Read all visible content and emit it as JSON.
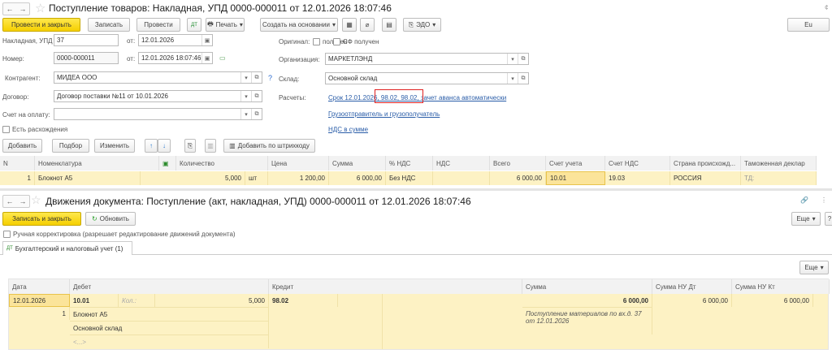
{
  "doc": {
    "title": "Поступление товаров: Накладная, УПД 0000-000011 от 12.01.2026 18:07:46",
    "toolbar": {
      "post_close": "Провести и закрыть",
      "save": "Записать",
      "post": "Провести",
      "print": "Печать",
      "create_based": "Создать на основании",
      "edo": "ЭДО",
      "more": "Eu"
    },
    "fields": {
      "invoice_label": "Накладная, УПД №:",
      "invoice_no": "37",
      "from": "от:",
      "invoice_date": "12.01.2026",
      "number_label": "Номер:",
      "number": "0000-000011",
      "doc_date": "12.01.2026 18:07:46",
      "counterparty_label": "Контрагент:",
      "counterparty": "МИДЕА ООО",
      "contract_label": "Договор:",
      "contract": "Договор поставки №11 от 10.01.2026",
      "payment_label": "Счет на оплату:",
      "payment": "",
      "discrepancy": "Есть расхождения",
      "original_label": "Оригинал:",
      "received": "получен",
      "sf_received": "СФ получен",
      "org_label": "Организация:",
      "org": "МАРКЕТЛЭНД",
      "warehouse_label": "Склад:",
      "warehouse": "Основной склад",
      "settlements_label": "Расчеты:",
      "settlements_link": "Срок 12.01.2026, 98.02, 98.02, зачет аванса автоматически",
      "shipper_link": "Грузоотправитель и грузополучатель",
      "vat_link": "НДС в сумме",
      "help": "?"
    },
    "table_toolbar": {
      "add": "Добавить",
      "pick": "Подбор",
      "edit": "Изменить",
      "add_barcode": "Добавить по штрихкоду"
    },
    "columns": [
      "N",
      "Номенклатура",
      "Количество",
      "Цена",
      "Сумма",
      "% НДС",
      "НДС",
      "Всего",
      "Счет учета",
      "Счет НДС",
      "Страна происхожд...",
      "Таможенная деклар"
    ],
    "rows": [
      {
        "n": "1",
        "item": "Блокнот А5",
        "qty": "5,000",
        "unit": "шт",
        "price": "1 200,00",
        "sum": "6 000,00",
        "vat_rate": "Без НДС",
        "vat": "",
        "total": "6 000,00",
        "account": "10.01",
        "vat_account": "19.03",
        "country": "РОССИЯ",
        "customs": "ТД:"
      }
    ]
  },
  "movements": {
    "title": "Движения документа: Поступление (акт, накладная, УПД) 0000-000011 от 12.01.2026 18:07:46",
    "save_close": "Записать и закрыть",
    "refresh": "Обновить",
    "more": "Еще",
    "help": "?",
    "manual": "Ручная корректировка (разрешает редактирование движений документа)",
    "tab": "Бухгалтерский и налоговый учет (1)",
    "table_more": "Еще",
    "columns": [
      "Дата",
      "Дебет",
      "Кредит",
      "Сумма",
      "Сумма НУ Дт",
      "Сумма НУ Кт"
    ],
    "row": {
      "date": "12.01.2026",
      "n": "1",
      "debit": "10.01",
      "qty_label": "Кол.:",
      "qty": "5,000",
      "sub1": "Блокнот А5",
      "sub2": "Основной склад",
      "sub3": "<...>",
      "credit": "98.02",
      "sum": "6 000,00",
      "content": "Поступление материалов по вх.д. 37 от 12.01.2026",
      "nu_dt": "6 000,00",
      "nu_kt": "6 000,00"
    }
  }
}
